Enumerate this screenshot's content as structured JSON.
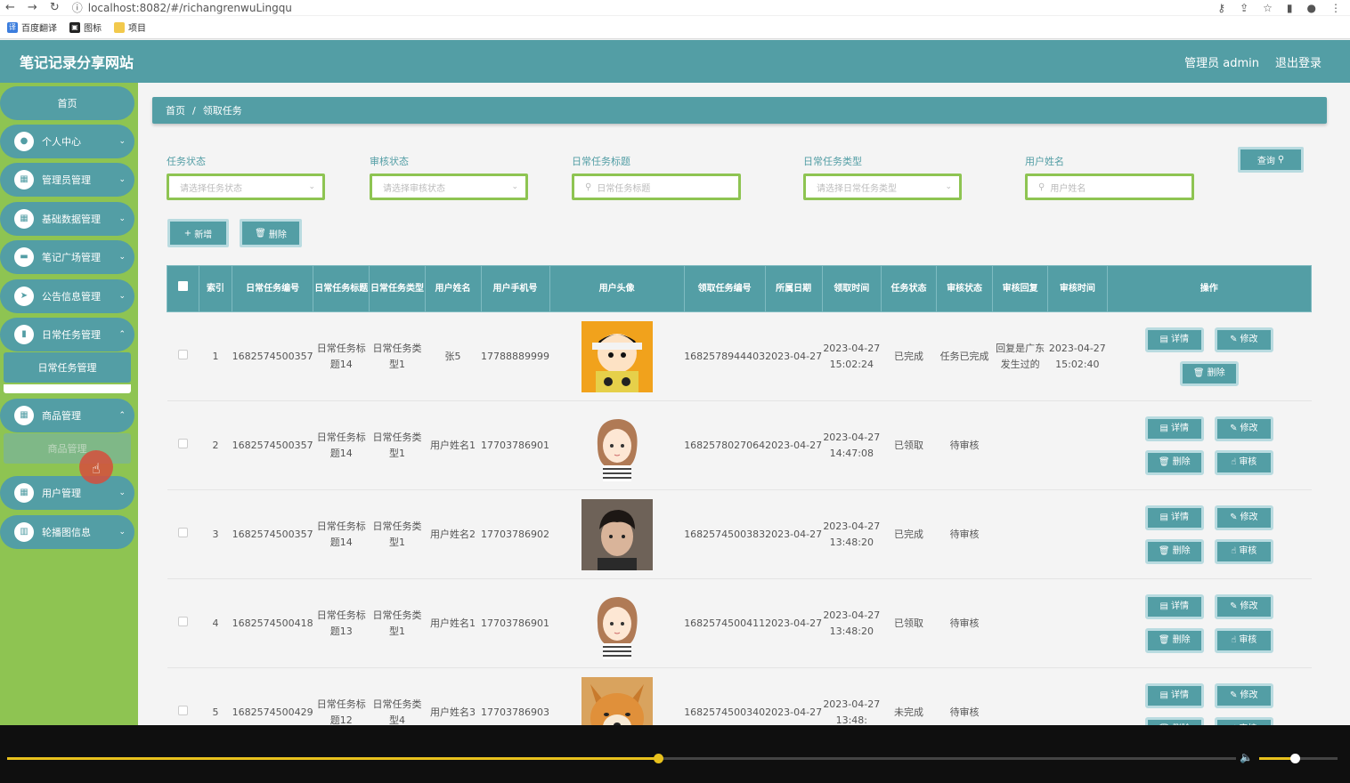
{
  "browser": {
    "url": "localhost:8082/#/richangrenwuLingqu",
    "bookmarks": [
      "百度翻译",
      "图标",
      "项目"
    ]
  },
  "header": {
    "title": "笔记记录分享网站",
    "user": "管理员 admin",
    "logout": "退出登录"
  },
  "sidebar": {
    "home": "首页",
    "menus": [
      "个人中心",
      "管理员管理",
      "基础数据管理",
      "笔记广场管理",
      "公告信息管理",
      "日常任务管理"
    ],
    "sub_task": "日常任务管理",
    "menus2": [
      "商品管理"
    ],
    "sub_goods": "商品管理",
    "menus3": [
      "用户管理",
      "轮播图信息"
    ]
  },
  "breadcrumb": {
    "home": "首页",
    "sep": "/",
    "current": "领取任务"
  },
  "filters": {
    "task_status": {
      "label": "任务状态",
      "placeholder": "请选择任务状态"
    },
    "audit_status": {
      "label": "审核状态",
      "placeholder": "请选择审核状态"
    },
    "task_title": {
      "label": "日常任务标题",
      "placeholder": "日常任务标题"
    },
    "task_type": {
      "label": "日常任务类型",
      "placeholder": "请选择日常任务类型"
    },
    "user_name": {
      "label": "用户姓名",
      "placeholder": "用户姓名"
    },
    "query": "查询"
  },
  "actions": {
    "add": "新增",
    "delete": "删除"
  },
  "table": {
    "headers": [
      "索引",
      "日常任务编号",
      "日常任务标题",
      "日常任务类型",
      "用户姓名",
      "用户手机号",
      "用户头像",
      "领取任务编号",
      "所属日期",
      "领取时间",
      "任务状态",
      "审核状态",
      "审核回复",
      "审核时间",
      "操作"
    ],
    "ops": {
      "detail": "详情",
      "edit": "修改",
      "delete": "删除",
      "audit": "审核"
    },
    "rows": [
      {
        "idx": "1",
        "no": "1682574500357",
        "title": "日常任务标题14",
        "type": "日常任务类型1",
        "name": "张5",
        "phone": "17788889999",
        "avatar": "cartoon-boy",
        "take_no": "1682578944403",
        "date": "2023-04-27",
        "time": "2023-04-27 15:02:24",
        "status": "已完成",
        "audit": "任务已完成",
        "reply": "回复是广东发生过的",
        "audit_time": "2023-04-27 15:02:40"
      },
      {
        "idx": "2",
        "no": "1682574500357",
        "title": "日常任务标题14",
        "type": "日常任务类型1",
        "name": "用户姓名1",
        "phone": "17703786901",
        "avatar": "cartoon-girl",
        "take_no": "1682578027064",
        "date": "2023-04-27",
        "time": "2023-04-27 14:47:08",
        "status": "已领取",
        "audit": "待审核",
        "reply": "",
        "audit_time": ""
      },
      {
        "idx": "3",
        "no": "1682574500357",
        "title": "日常任务标题14",
        "type": "日常任务类型1",
        "name": "用户姓名2",
        "phone": "17703786902",
        "avatar": "photo-man",
        "take_no": "1682574500383",
        "date": "2023-04-27",
        "time": "2023-04-27 13:48:20",
        "status": "已完成",
        "audit": "待审核",
        "reply": "",
        "audit_time": ""
      },
      {
        "idx": "4",
        "no": "1682574500418",
        "title": "日常任务标题13",
        "type": "日常任务类型1",
        "name": "用户姓名1",
        "phone": "17703786901",
        "avatar": "cartoon-girl",
        "take_no": "1682574500411",
        "date": "2023-04-27",
        "time": "2023-04-27 13:48:20",
        "status": "已领取",
        "audit": "待审核",
        "reply": "",
        "audit_time": ""
      },
      {
        "idx": "5",
        "no": "1682574500429",
        "title": "日常任务标题12",
        "type": "日常任务类型4",
        "name": "用户姓名3",
        "phone": "17703786903",
        "avatar": "shiba-dog",
        "take_no": "1682574500340",
        "date": "2023-04-27",
        "time": "2023-04-27 13:48:",
        "status": "未完成",
        "audit": "待审核",
        "reply": "",
        "audit_time": ""
      }
    ]
  },
  "video": {
    "progress": 0.53,
    "volume": 0.45,
    "accent": "#e8c11d"
  },
  "colors": {
    "teal": "#539ea5",
    "green": "#8ec452"
  }
}
